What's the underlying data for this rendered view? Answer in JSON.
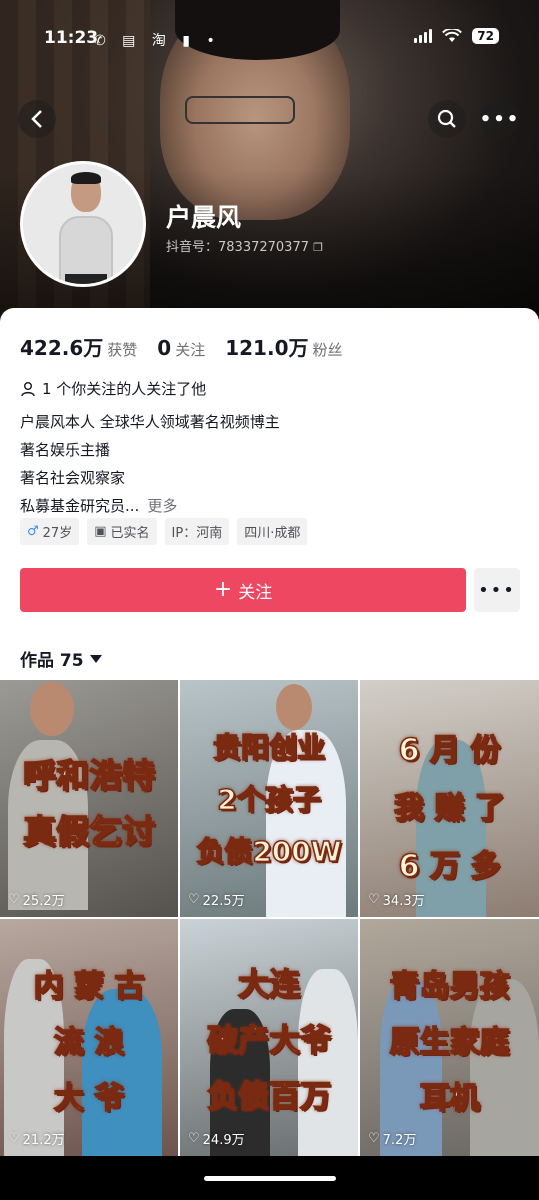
{
  "status_bar": {
    "time": "11:23",
    "battery": "72"
  },
  "profile": {
    "name": "户晨风",
    "douyin_id": "抖音号：78337270377",
    "stats": [
      {
        "value": "422.6万",
        "label": "获赞"
      },
      {
        "value": "0",
        "label": "关注"
      },
      {
        "value": "121.0万",
        "label": "粉丝"
      }
    ],
    "mutual": "1 个你关注的人关注了他",
    "bio": [
      "户晨风本人  全球华人领域著名视频博主",
      "著名娱乐主播",
      "著名社会观察家",
      "私募基金研究员..."
    ],
    "bio_more": "更多",
    "tags": {
      "age": "27岁",
      "verified": "已实名",
      "ip": "IP：河南",
      "location": "四川·成都"
    },
    "follow_label": "关注",
    "works_label": "作品 75"
  },
  "videos": [
    {
      "lines": [
        "呼和浩特",
        "真假乞讨"
      ],
      "likes": "25.2万",
      "bg": "#6a6a66"
    },
    {
      "lines": [
        "贵阳创业",
        "2个孩子",
        "负债200W"
      ],
      "likes": "22.5万",
      "bg": "#7a8a8c"
    },
    {
      "lines": [
        "6 月 份",
        "我 赚 了",
        "6 万 多"
      ],
      "likes": "34.3万",
      "bg": "#8a7770"
    },
    {
      "lines": [
        "内 蒙 古",
        "流 浪",
        "大 爷"
      ],
      "likes": "21.2万",
      "bg": "#8a6a60"
    },
    {
      "lines": [
        "大连",
        "破产大爷",
        "负债百万"
      ],
      "likes": "24.9万",
      "bg": "#7d8a90"
    },
    {
      "lines": [
        "青岛男孩",
        "原生家庭",
        "耳机"
      ],
      "likes": "7.2万",
      "bg": "#8b8a86"
    }
  ]
}
